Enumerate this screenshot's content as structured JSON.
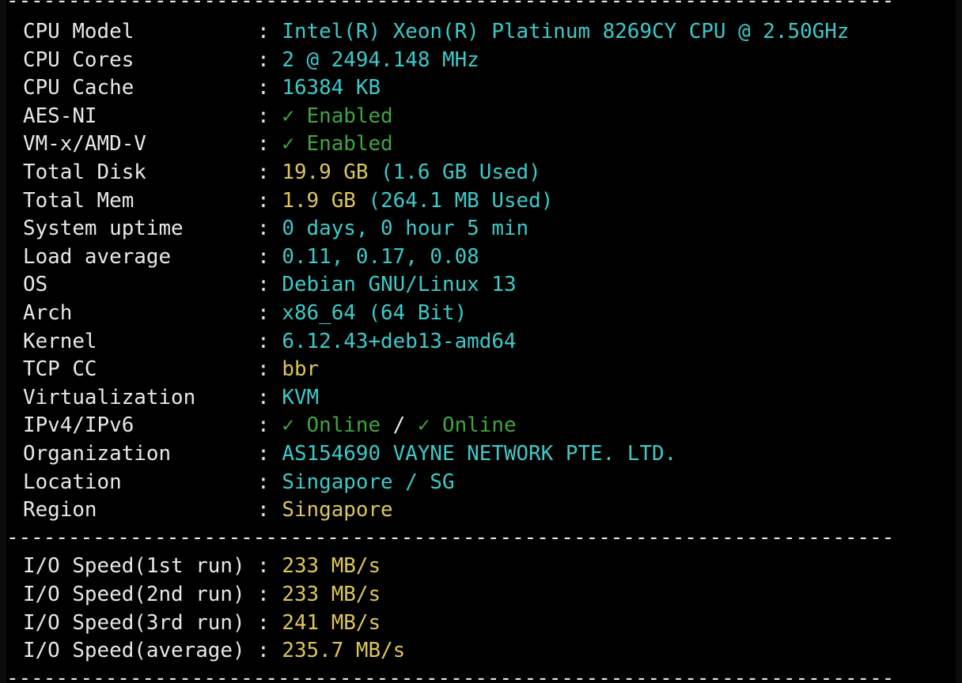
{
  "separator": "-------------------------------------------------------------------------",
  "system_info": [
    {
      "key": "CPU Model",
      "parts": [
        {
          "text": "Intel(R) Xeon(R) Platinum 8269CY CPU @ 2.50GHz",
          "color": "cyan"
        }
      ]
    },
    {
      "key": "CPU Cores",
      "parts": [
        {
          "text": "2 @ 2494.148 MHz",
          "color": "cyan"
        }
      ]
    },
    {
      "key": "CPU Cache",
      "parts": [
        {
          "text": "16384 KB",
          "color": "cyan"
        }
      ]
    },
    {
      "key": "AES-NI",
      "parts": [
        {
          "text": "✓ Enabled",
          "color": "green"
        }
      ]
    },
    {
      "key": "VM-x/AMD-V",
      "parts": [
        {
          "text": "✓ Enabled",
          "color": "green"
        }
      ]
    },
    {
      "key": "Total Disk",
      "parts": [
        {
          "text": "19.9 GB",
          "color": "yellow"
        },
        {
          "text": " (1.6 GB Used)",
          "color": "cyan"
        }
      ]
    },
    {
      "key": "Total Mem",
      "parts": [
        {
          "text": "1.9 GB",
          "color": "yellow"
        },
        {
          "text": " (264.1 MB Used)",
          "color": "cyan"
        }
      ]
    },
    {
      "key": "System uptime",
      "parts": [
        {
          "text": "0 days, 0 hour 5 min",
          "color": "cyan"
        }
      ]
    },
    {
      "key": "Load average",
      "parts": [
        {
          "text": "0.11, 0.17, 0.08",
          "color": "cyan"
        }
      ]
    },
    {
      "key": "OS",
      "parts": [
        {
          "text": "Debian GNU/Linux 13",
          "color": "cyan"
        }
      ]
    },
    {
      "key": "Arch",
      "parts": [
        {
          "text": "x86_64 (64 Bit)",
          "color": "cyan"
        }
      ]
    },
    {
      "key": "Kernel",
      "parts": [
        {
          "text": "6.12.43+deb13-amd64",
          "color": "cyan"
        }
      ]
    },
    {
      "key": "TCP CC",
      "parts": [
        {
          "text": "bbr",
          "color": "yellow"
        }
      ]
    },
    {
      "key": "Virtualization",
      "parts": [
        {
          "text": "KVM",
          "color": "cyan"
        }
      ]
    },
    {
      "key": "IPv4/IPv6",
      "parts": [
        {
          "text": "✓ Online",
          "color": "green"
        },
        {
          "text": " / ",
          "color": "white"
        },
        {
          "text": "✓ Online",
          "color": "green"
        }
      ]
    },
    {
      "key": "Organization",
      "parts": [
        {
          "text": "AS154690 VAYNE NETWORK PTE. LTD.",
          "color": "cyan"
        }
      ]
    },
    {
      "key": "Location",
      "parts": [
        {
          "text": "Singapore / SG",
          "color": "cyan"
        }
      ]
    },
    {
      "key": "Region",
      "parts": [
        {
          "text": "Singapore",
          "color": "yellow"
        }
      ]
    }
  ],
  "io_speed": [
    {
      "key": "I/O Speed(1st run)",
      "parts": [
        {
          "text": "233 MB/s",
          "color": "yellow"
        }
      ]
    },
    {
      "key": "I/O Speed(2nd run)",
      "parts": [
        {
          "text": "233 MB/s",
          "color": "yellow"
        }
      ]
    },
    {
      "key": "I/O Speed(3rd run)",
      "parts": [
        {
          "text": "241 MB/s",
          "color": "yellow"
        }
      ]
    },
    {
      "key": "I/O Speed(average)",
      "parts": [
        {
          "text": "235.7 MB/s",
          "color": "yellow"
        }
      ]
    }
  ],
  "colors": {
    "background": "#000000",
    "text": "#e8e8e8",
    "cyan": "#3ec9c9",
    "yellow": "#dcc65a",
    "green": "#3fa53f"
  }
}
